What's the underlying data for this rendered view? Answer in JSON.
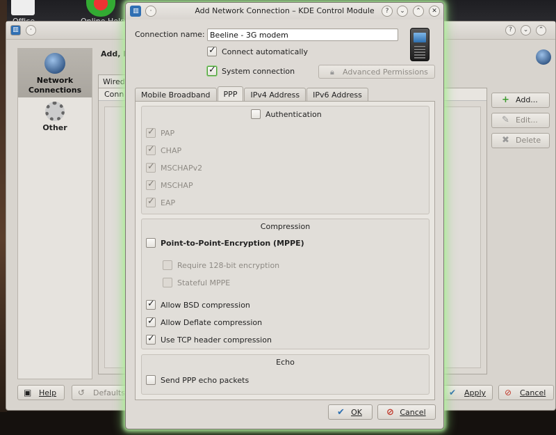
{
  "desktop": {
    "icon_labels": [
      "Office",
      "Online Help"
    ]
  },
  "background_window": {
    "sidebar": {
      "items": [
        {
          "label": "Network Connections",
          "icon": "network-globe-icon",
          "active": true
        },
        {
          "label": "Other",
          "icon": "gear-icon",
          "active": false
        }
      ]
    },
    "heading": "Add, E",
    "tab_label": "Wired",
    "list_header": "Conn",
    "right_buttons": [
      {
        "label": "Add...",
        "icon": "plus-icon",
        "enabled": true
      },
      {
        "label": "Edit...",
        "icon": "edit-icon",
        "enabled": false
      },
      {
        "label": "Delete",
        "icon": "delete-icon",
        "enabled": false
      }
    ],
    "bottom_buttons": {
      "help": "Help",
      "defaults": "Defaults",
      "apply": "Apply",
      "cancel": "Cancel"
    }
  },
  "dialog": {
    "title": "Add Network Connection – KDE Control Module",
    "titlebar_buttons": [
      "?",
      "⌄",
      "⌃",
      "✕"
    ],
    "connection_name_label": "Connection name:",
    "connection_name_value": "Beeline - 3G modem",
    "connect_automatically": {
      "label": "Connect automatically",
      "checked": true
    },
    "system_connection": {
      "label": "System connection",
      "checked": true
    },
    "advanced_permissions": {
      "label": "Advanced Permissions",
      "enabled": false
    },
    "tabs": [
      {
        "label": "Mobile Broadband",
        "active": false
      },
      {
        "label": "PPP",
        "active": true
      },
      {
        "label": "IPv4 Address",
        "active": false
      },
      {
        "label": "IPv6 Address",
        "active": false
      }
    ],
    "ppp": {
      "authentication": {
        "label": "Authentication",
        "checked": false,
        "methods": [
          {
            "label": "PAP",
            "checked": true,
            "enabled": false
          },
          {
            "label": "CHAP",
            "checked": true,
            "enabled": false
          },
          {
            "label": "MSCHAPv2",
            "checked": true,
            "enabled": false
          },
          {
            "label": "MSCHAP",
            "checked": true,
            "enabled": false
          },
          {
            "label": "EAP",
            "checked": true,
            "enabled": false
          }
        ]
      },
      "compression": {
        "title": "Compression",
        "mppe": {
          "label": "Point-to-Point-Encryption (MPPE)",
          "checked": false
        },
        "require_128": {
          "label": "Require 128-bit encryption",
          "checked": false,
          "enabled": false
        },
        "stateful_mppe": {
          "label": "Stateful MPPE",
          "checked": false,
          "enabled": false
        },
        "bsd": {
          "label": "Allow BSD compression",
          "checked": true
        },
        "deflate": {
          "label": "Allow Deflate compression",
          "checked": true
        },
        "tcp_header": {
          "label": "Use TCP header compression",
          "checked": true
        }
      },
      "echo": {
        "title": "Echo",
        "send_echo": {
          "label": "Send PPP echo packets",
          "checked": false
        }
      }
    },
    "buttons": {
      "ok": "OK",
      "cancel": "Cancel"
    }
  },
  "colors": {
    "dialog_glow": "#8ed57a",
    "ok_icon": "#2d6fb0",
    "cancel_icon": "#c0392b",
    "add_icon": "#3c9a2e"
  }
}
